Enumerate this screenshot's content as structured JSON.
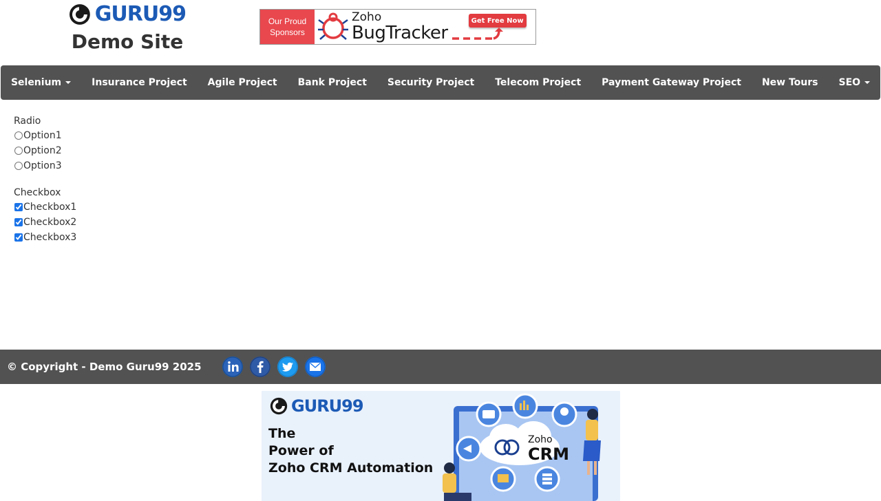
{
  "header": {
    "logo_text": "GURU99",
    "logo_subtitle": "Demo Site",
    "sponsor": {
      "left_line1": "Our Proud",
      "left_line2": "Sponsors",
      "brand": "Zoho",
      "product": "BugTracker",
      "cta": "Get Free Now"
    }
  },
  "nav": {
    "items": [
      {
        "label": "Selenium",
        "dropdown": true
      },
      {
        "label": "Insurance Project",
        "dropdown": false
      },
      {
        "label": "Agile Project",
        "dropdown": false
      },
      {
        "label": "Bank Project",
        "dropdown": false
      },
      {
        "label": "Security Project",
        "dropdown": false
      },
      {
        "label": "Telecom Project",
        "dropdown": false
      },
      {
        "label": "Payment Gateway Project",
        "dropdown": false
      },
      {
        "label": "New Tours",
        "dropdown": false
      },
      {
        "label": "SEO",
        "dropdown": true
      }
    ]
  },
  "form": {
    "radio": {
      "label": "Radio",
      "options": [
        {
          "label": "Option1",
          "checked": false
        },
        {
          "label": "Option2",
          "checked": false
        },
        {
          "label": "Option3",
          "checked": false
        }
      ]
    },
    "checkbox": {
      "label": "Checkbox",
      "options": [
        {
          "label": "Checkbox1",
          "checked": true
        },
        {
          "label": "Checkbox2",
          "checked": true
        },
        {
          "label": "Checkbox3",
          "checked": true
        }
      ]
    }
  },
  "footer": {
    "copyright": "© Copyright - Demo Guru99 2025",
    "social": [
      {
        "name": "linkedin-icon",
        "color": "#1a5fb4"
      },
      {
        "name": "facebook-icon",
        "color": "#2a5298"
      },
      {
        "name": "twitter-icon",
        "color": "#1d9bf0"
      },
      {
        "name": "email-icon",
        "color": "#1a73e8"
      }
    ]
  },
  "bottom_ad": {
    "logo_text": "GURU99",
    "headline_line1": "The",
    "headline_line2": "Power of",
    "headline_line3": "Zoho CRM Automation",
    "crm_brand": "Zoho",
    "crm_product": "CRM"
  },
  "colors": {
    "brand_blue": "#1c5ab5",
    "nav_bg": "#525252",
    "sponsor_red": "#e8484e"
  }
}
